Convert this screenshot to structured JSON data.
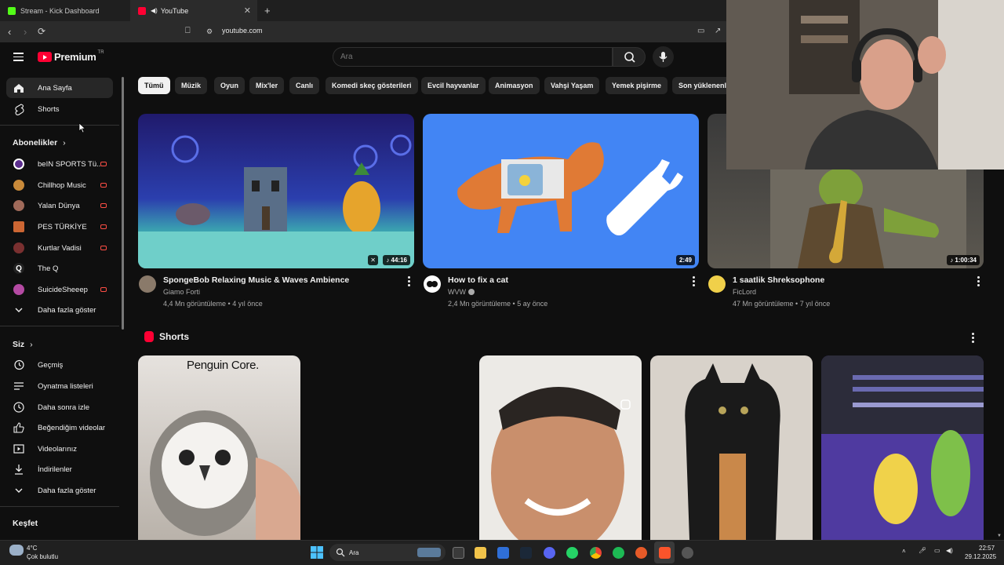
{
  "browser": {
    "tabs": [
      {
        "title": "Stream - Kick Dashboard",
        "favicon_color": "#53fc18"
      },
      {
        "title": "YouTube",
        "favicon_color": "#ff0033"
      }
    ],
    "new_tab_glyph": "+",
    "close_glyph": "✕",
    "url": "youtube.com"
  },
  "header": {
    "logo_text": "Premium",
    "logo_sup": "TR",
    "search_placeholder": "Ara"
  },
  "sidebar": {
    "main": [
      {
        "label": "Ana Sayfa",
        "icon": "home-icon"
      },
      {
        "label": "Shorts",
        "icon": "shorts-icon"
      }
    ],
    "subscriptions_title": "Abonelikler",
    "subscriptions": [
      {
        "label": "beIN SPORTS Tü...",
        "color": "#5b2d8e"
      },
      {
        "label": "Chillhop Music",
        "color": "#c98a3a"
      },
      {
        "label": "Yalan Dünya",
        "color": "#a06a5a"
      },
      {
        "label": "PES TÜRKİYE",
        "color": "#c63"
      },
      {
        "label": "Kurtlar Vadisi",
        "color": "#7a3030"
      },
      {
        "label": "The Q",
        "color": "#222"
      },
      {
        "label": "SuicideSheeep",
        "color": "#b44aa3"
      }
    ],
    "show_more": "Daha fazla göster",
    "you_title": "Siz",
    "you_items": [
      {
        "label": "Geçmiş",
        "icon": "history-icon"
      },
      {
        "label": "Oynatma listeleri",
        "icon": "playlists-icon"
      },
      {
        "label": "Daha sonra izle",
        "icon": "watch-later-icon"
      },
      {
        "label": "Beğendiğim videolar",
        "icon": "like-icon"
      },
      {
        "label": "Videolarınız",
        "icon": "your-videos-icon"
      },
      {
        "label": "İndirilenler",
        "icon": "download-icon"
      }
    ],
    "you_show_more": "Daha fazla göster",
    "explore_title": "Keşfet"
  },
  "chips": [
    "Tümü",
    "Müzik",
    "Oyun",
    "Mix'ler",
    "Canlı",
    "Komedi skeç gösterileri",
    "Evcil hayvanlar",
    "Animasyon",
    "Vahşi Yaşam",
    "Yemek pişirme",
    "Son yüklenenler"
  ],
  "videos": [
    {
      "title": "SpongeBob Relaxing Music & Waves Ambience",
      "channel": "Giamo Forti",
      "meta": "4,4 Mn görüntüleme • 4 yıl önce",
      "duration": "♪ 44:16",
      "verified": false
    },
    {
      "title": "How to fix a cat",
      "channel": "WVW",
      "meta": "2,4 Mn görüntüleme • 5 ay önce",
      "duration": "2:49",
      "verified": true
    },
    {
      "title": "1 saatlik Shreksophone",
      "channel": "FicLord",
      "meta": "47 Mn görüntüleme • 7 yıl önce",
      "duration": "♪ 1:00:34",
      "verified": false
    }
  ],
  "shorts": {
    "title": "Shorts",
    "items": [
      {
        "caption": "Penguin Core."
      },
      {
        "caption": ""
      },
      {
        "caption": ""
      },
      {
        "caption": ""
      }
    ]
  },
  "taskbar": {
    "weather_temp": "4°C",
    "weather_desc": "Çok bulutlu",
    "search_label": "Ara",
    "time": "22:57",
    "date": "29.12.2025"
  }
}
